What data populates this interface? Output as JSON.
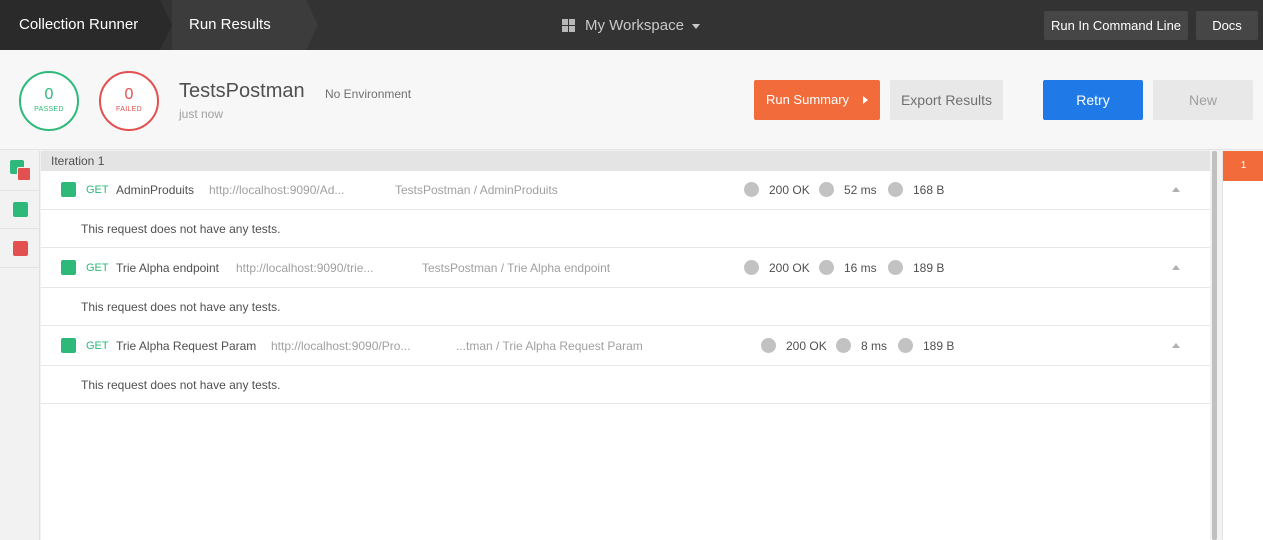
{
  "topbar": {
    "crumb1": "Collection Runner",
    "crumb2": "Run Results",
    "workspace": "My Workspace",
    "cli_label": "Run In Command Line",
    "docs_label": "Docs"
  },
  "summary": {
    "passed_count": "0",
    "passed_label": "PASSED",
    "failed_count": "0",
    "failed_label": "FAILED",
    "collection_name": "TestsPostman",
    "environment": "No Environment",
    "time": "just now",
    "run_summary_label": "Run Summary",
    "export_label": "Export Results",
    "retry_label": "Retry",
    "new_label": "New"
  },
  "colors": {
    "pass": "#2eb87a",
    "fail": "#e2504f",
    "accent": "#f26b3a",
    "primary": "#1f7ae8"
  },
  "iteration": {
    "label": "Iteration 1",
    "tab_number": "1"
  },
  "requests": [
    {
      "method": "GET",
      "name": "AdminProduits",
      "url": "http://localhost:9090/Ad...",
      "path": "TestsPostman / AdminProduits",
      "status": "200 OK",
      "time": "52 ms",
      "size": "168 B",
      "note": "This request does not have any tests."
    },
    {
      "method": "GET",
      "name": "Trie Alpha endpoint",
      "url": "http://localhost:9090/trie...",
      "path": "TestsPostman / Trie Alpha endpoint",
      "status": "200 OK",
      "time": "16 ms",
      "size": "189 B",
      "note": "This request does not have any tests."
    },
    {
      "method": "GET",
      "name": "Trie Alpha Request Param",
      "url": "http://localhost:9090/Pro...",
      "path": "...tman / Trie Alpha Request Param",
      "status": "200 OK",
      "time": "8 ms",
      "size": "189 B",
      "note": "This request does not have any tests."
    }
  ]
}
